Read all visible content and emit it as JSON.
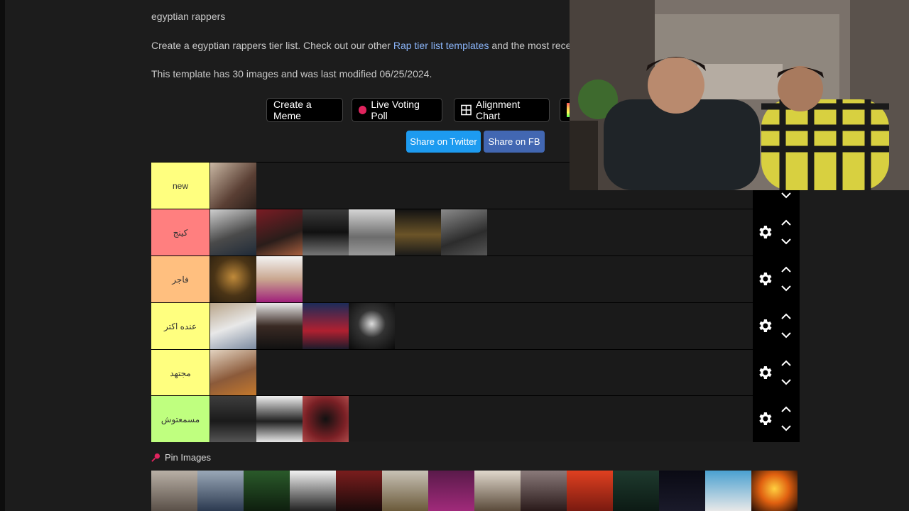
{
  "header": {
    "title": "egyptian rappers",
    "desc_prefix": "Create a egyptian rappers tier list. Check out our other ",
    "desc_link": "Rap tier list templates",
    "desc_suffix": " and the most recen",
    "meta": "This template has 30 images and was last modified 06/25/2024."
  },
  "buttons": {
    "create_meme": "Create a Meme",
    "live_poll": "Live Voting Poll",
    "alignment": "Alignment Chart",
    "share_twitter": "Share on Twitter",
    "share_fb": "Share on FB"
  },
  "colors": {
    "tier_new": "#ffff7f",
    "tier_1": "#ff7f7f",
    "tier_2": "#ffbf7f",
    "tier_3": "#ffff7f",
    "tier_4": "#ffff7f",
    "tier_5": "#bfff7f",
    "twitter": "#1d9bf0",
    "fb": "#4267b2",
    "poll_dot": "#e0245e"
  },
  "tiers": [
    {
      "label": "new",
      "count": 1
    },
    {
      "label": "كينج",
      "count": 6
    },
    {
      "label": "فاجر",
      "count": 2
    },
    {
      "label": "عنده اكتر",
      "count": 4
    },
    {
      "label": "مجتهد",
      "count": 1
    },
    {
      "label": "مسمعتوش",
      "count": 3
    }
  ],
  "pin": {
    "label": "Pin Images"
  }
}
